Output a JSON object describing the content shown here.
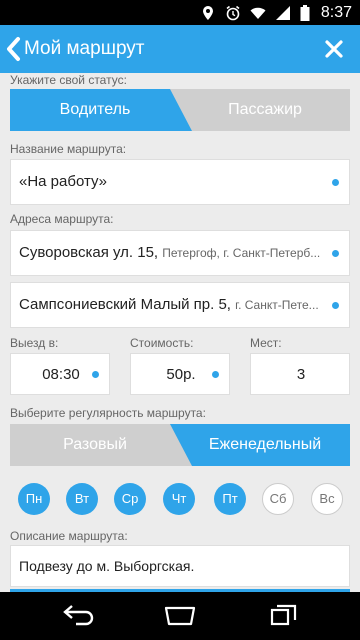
{
  "status_bar": {
    "time": "8:37"
  },
  "app_bar": {
    "title": "Мой маршрут"
  },
  "status": {
    "label": "Укажите свой статус:",
    "options": [
      "Водитель",
      "Пассажир"
    ],
    "selected": "Водитель"
  },
  "route_name": {
    "label": "Название маршрута:",
    "value": "«На работу»"
  },
  "addresses": {
    "label": "Адреса маршрута:",
    "items": [
      {
        "main": "Суворовская ул. 15,",
        "detail": "Петергоф, г. Санкт-Петерб..."
      },
      {
        "main": "Сампсониевский Малый пр. 5,",
        "detail": "г. Санкт-Пете..."
      }
    ]
  },
  "departure": {
    "label": "Выезд в:",
    "value": "08:30"
  },
  "cost": {
    "label": "Стоимость:",
    "value": "50р."
  },
  "seats": {
    "label": "Мест:",
    "value": "3"
  },
  "regularity": {
    "label": "Выберите регулярность маршрута:",
    "options": [
      "Разовый",
      "Еженедельный"
    ],
    "selected": "Еженедельный"
  },
  "days": [
    {
      "label": "Пн",
      "active": true
    },
    {
      "label": "Вт",
      "active": true
    },
    {
      "label": "Ср",
      "active": true
    },
    {
      "label": "Чт",
      "active": true
    },
    {
      "label": "Пт",
      "active": true
    },
    {
      "label": "Сб",
      "active": false
    },
    {
      "label": "Вс",
      "active": false
    }
  ],
  "description": {
    "label": "Описание маршрута:",
    "value": "Подвезу до м. Выборгская."
  },
  "colors": {
    "accent": "#2fa4e9",
    "inactive": "#cfcfcf",
    "background": "#ececec"
  }
}
